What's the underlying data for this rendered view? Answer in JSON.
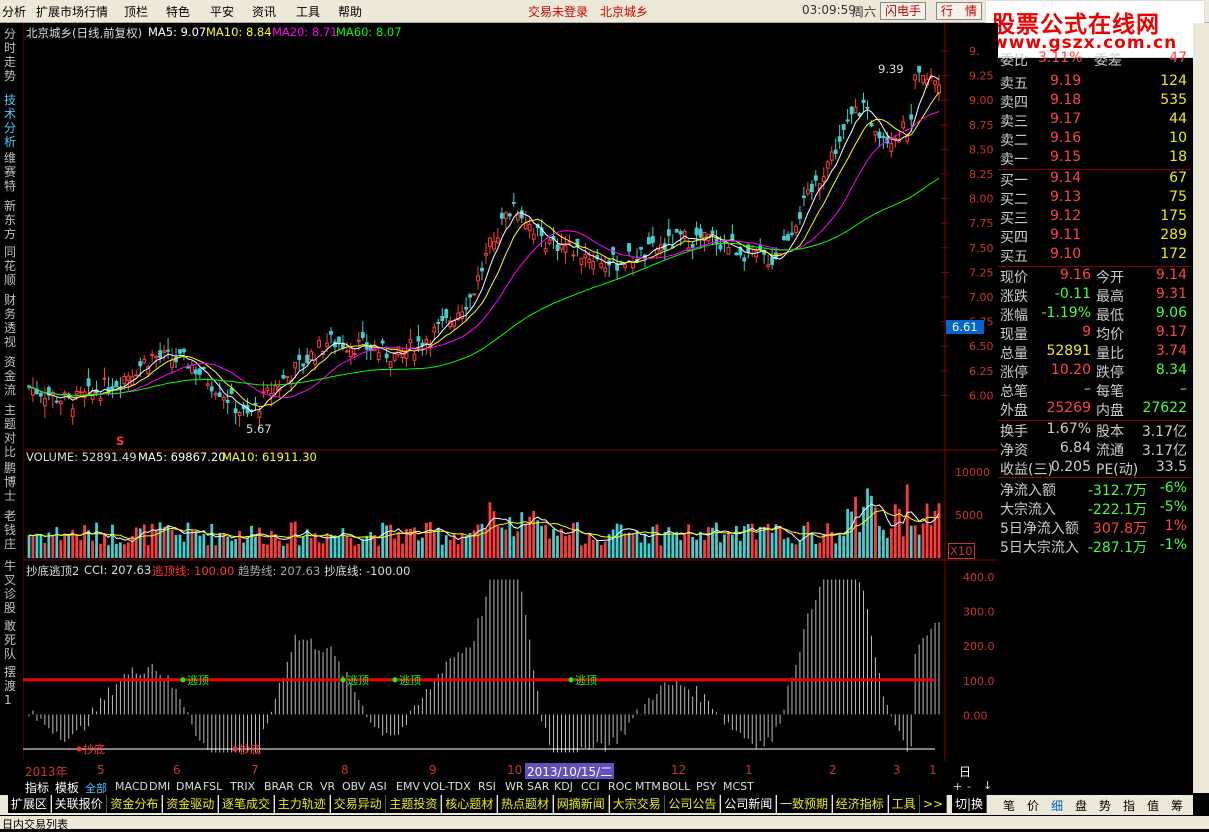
{
  "menu": {
    "items": [
      "分析",
      "扩展市场行情",
      "顶栏",
      "特色",
      "平安",
      "资讯",
      "工具",
      "帮助"
    ],
    "status_login": "交易未登录",
    "status_stock": "北京城乡",
    "clock": "03:09:59",
    "weekday": "周六",
    "btn_flash": "闪电手",
    "btn_quote": "行　情"
  },
  "logo": {
    "line1": "股票公式在线网",
    "line2": "www.gszx.com.cn"
  },
  "left_tabs": [
    "分时走势",
    "技术分析",
    "维赛特",
    "新东方",
    "同花顺",
    "财务透视",
    "资金流",
    "主题对比",
    "鹏博士",
    "老钱庄",
    "牛叉诊股",
    "敢死队",
    "摆渡1"
  ],
  "main_chart": {
    "title": "北京城乡(日线,前复权)",
    "ma5": "MA5: 9.07",
    "ma10": "MA10: 8.84",
    "ma20": "MA20: 8.71",
    "ma60": "MA60: 8.07",
    "high_label": "9.39",
    "low_label": "5.67",
    "current_price_tag": "6.61",
    "s_marker": "S",
    "y_ticks": [
      "9.",
      "9.25",
      "9.00",
      "8.75",
      "8.50",
      "8.25",
      "8.00",
      "7.75",
      "7.50",
      "7.25",
      "7.00",
      "6.75",
      "6.50",
      "6.25",
      "6.00"
    ]
  },
  "volume_chart": {
    "label": "VOLUME: 52891.49",
    "ma5": "MA5: 69867.20",
    "ma10": "MA10: 61911.30",
    "y_ticks": [
      "10000",
      "5000"
    ],
    "unit": "X10"
  },
  "indicator_chart": {
    "name": "抄底逃顶2",
    "cci": "CCI: 207.63",
    "escape_line": "逃顶线: 100.00",
    "trend_line": "趋势线: 207.63",
    "bottom_line": "抄底线: -100.00",
    "y_ticks": [
      "400.0",
      "300.0",
      "200.0",
      "100.0",
      "0.00"
    ],
    "signal_top": "逃顶",
    "signal_bottom": "抄底"
  },
  "x_axis": {
    "labels": [
      "2013年",
      "5",
      "6",
      "7",
      "8",
      "9",
      "10",
      "2013/10/15/二",
      "12",
      "1",
      "2",
      "3",
      "1"
    ],
    "period": "日线"
  },
  "indicator_tabs": [
    "指标",
    "模板",
    "全部",
    "MACD",
    "DMI",
    "DMA",
    "FSL",
    "TRIX",
    "BRAR",
    "CR",
    "VR",
    "OBV",
    "ASI",
    "EMV",
    "VOL-TDX",
    "RSI",
    "WR",
    "SAR",
    "KDJ",
    "CCI",
    "ROC",
    "MTM",
    "BOLL",
    "PSY",
    "MCST"
  ],
  "quote_panel": {
    "header": {
      "left": "委比",
      "left_val": "3.11%",
      "right": "委差",
      "right_val": "47"
    },
    "sell": [
      {
        "label": "卖五",
        "price": "9.19",
        "vol": "124"
      },
      {
        "label": "卖四",
        "price": "9.18",
        "vol": "535"
      },
      {
        "label": "卖三",
        "price": "9.17",
        "vol": "44"
      },
      {
        "label": "卖二",
        "price": "9.16",
        "vol": "10"
      },
      {
        "label": "卖一",
        "price": "9.15",
        "vol": "18"
      }
    ],
    "buy": [
      {
        "label": "买一",
        "price": "9.14",
        "vol": "67"
      },
      {
        "label": "买二",
        "price": "9.13",
        "vol": "75"
      },
      {
        "label": "买三",
        "price": "9.12",
        "vol": "175"
      },
      {
        "label": "买四",
        "price": "9.11",
        "vol": "289"
      },
      {
        "label": "买五",
        "price": "9.10",
        "vol": "172"
      }
    ],
    "stats": [
      {
        "l1": "现价",
        "v1": "9.16",
        "l2": "今开",
        "v2": "9.14",
        "c1": "#f44",
        "c2": "#f44"
      },
      {
        "l1": "涨跌",
        "v1": "-0.11",
        "l2": "最高",
        "v2": "9.31",
        "c1": "#4f4",
        "c2": "#f44"
      },
      {
        "l1": "涨幅",
        "v1": "-1.19%",
        "l2": "最低",
        "v2": "9.06",
        "c1": "#4f4",
        "c2": "#4f4"
      },
      {
        "l1": "现量",
        "v1": "9",
        "l2": "均价",
        "v2": "9.17",
        "c1": "#f44",
        "c2": "#f44"
      },
      {
        "l1": "总量",
        "v1": "52891",
        "l2": "量比",
        "v2": "3.74",
        "c1": "#ee0",
        "c2": "#f44"
      },
      {
        "l1": "涨停",
        "v1": "10.20",
        "l2": "跌停",
        "v2": "8.34",
        "c1": "#f44",
        "c2": "#4f4"
      },
      {
        "l1": "总笔",
        "v1": "–",
        "l2": "每笔",
        "v2": "–",
        "c1": "#ccc",
        "c2": "#ccc"
      },
      {
        "l1": "外盘",
        "v1": "25269",
        "l2": "内盘",
        "v2": "27622",
        "c1": "#f44",
        "c2": "#4f4"
      }
    ],
    "fund": [
      {
        "l1": "换手",
        "v1": "1.67%",
        "l2": "股本",
        "v2": "3.17亿"
      },
      {
        "l1": "净资",
        "v1": "6.84",
        "l2": "流通",
        "v2": "3.17亿"
      },
      {
        "l1": "收益(三)",
        "v1": "0.205",
        "l2": "PE(动)",
        "v2": "33.5"
      }
    ],
    "flow": [
      {
        "label": "净流入额",
        "val": "-312.7万",
        "pct": "-6%",
        "c": "#4f4"
      },
      {
        "label": "大宗流入",
        "val": "-222.1万",
        "pct": "-5%",
        "c": "#4f4"
      },
      {
        "label": "5日净流入额",
        "val": "307.8万",
        "pct": "1%",
        "c": "#f44"
      },
      {
        "label": "5日大宗流入",
        "val": "-287.1万",
        "pct": "-1%",
        "c": "#4f4"
      }
    ]
  },
  "bottom_tabs": [
    "扩展区",
    "关联报价",
    "资金分布",
    "资金驱动",
    "逐笔成交",
    "主力轨迹",
    "交易异动",
    "主题投资",
    "核心题材",
    "热点题材",
    "网摘新闻",
    "大宗交易",
    "公司公告",
    "公司新闻",
    "一致预期",
    "经济指标",
    "工具",
    ">>"
  ],
  "bottom_right": {
    "switch": "切|换",
    "tabs": [
      "笔",
      "价",
      "细",
      "盘",
      "势",
      "指",
      "值",
      "筹"
    ]
  },
  "status_text": "日内交易列表",
  "colors": {
    "up": "#ff3b3b",
    "down": "#3fd0d0",
    "ma5": "#ffffff",
    "ma10": "#ffff00",
    "ma20": "#ff00ff",
    "ma60": "#00ff00",
    "axis": "#880000"
  }
}
